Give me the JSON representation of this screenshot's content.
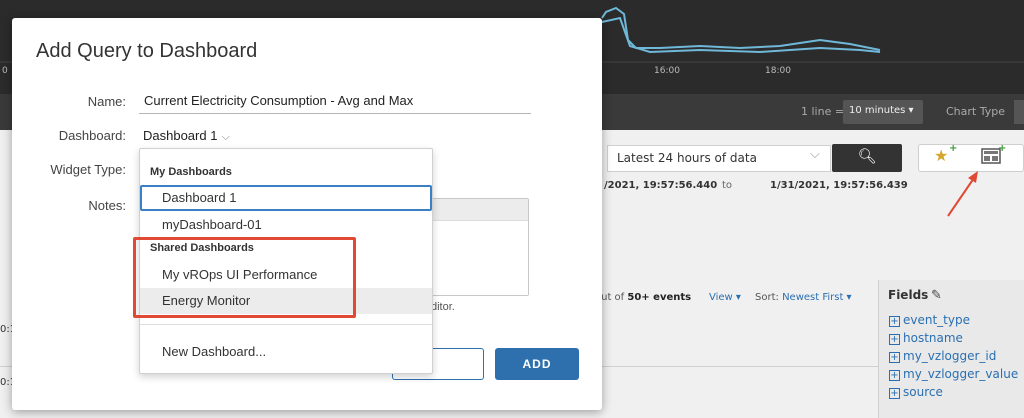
{
  "background": {
    "chart_ticks": [
      "0",
      "16:00",
      "18:00"
    ],
    "toolbar": {
      "one_line_label": "1 line =",
      "interval": "10 minutes ▾",
      "chart_type_label": "Chart Type"
    },
    "time_range_select": "Latest 24 hours of data",
    "range_start": "/2021, 19:57:56.440",
    "range_to": "to",
    "range_end": "1/31/2021, 19:57:56.439",
    "results_prefix": "out of",
    "results_count": "50+ events",
    "view_label": "View ▾",
    "sort_label": "Sort:",
    "sort_value": "Newest First ▾",
    "fields_title": "Fields",
    "fields": [
      "event_type",
      "hostname",
      "my_vzlogger_id",
      "my_vzlogger_value",
      "source"
    ],
    "edge_labels": [
      "0:1",
      "0:1"
    ]
  },
  "modal": {
    "title": "Add Query to Dashboard",
    "name_label": "Name:",
    "name_value": "Current Electricity Consumption - Avg and Max",
    "dashboard_label": "Dashboard:",
    "dashboard_value": "Dashboard 1",
    "widget_type_label": "Widget Type:",
    "notes_label": "Notes:",
    "editor_hint": "ditor.",
    "cancel_label": "NCEL",
    "add_label": "ADD"
  },
  "dropdown": {
    "my_header": "My Dashboards",
    "my_items": [
      "Dashboard 1",
      "myDashboard-01"
    ],
    "shared_header": "Shared Dashboards",
    "shared_items": [
      "My vROps UI Performance",
      "Energy Monitor"
    ],
    "new_item": "New Dashboard..."
  },
  "colors": {
    "accent": "#2e6fad",
    "annotation": "#e04a35",
    "chart_line": "#6fb8d9"
  },
  "icons": [
    "search-icon",
    "star-add-icon",
    "dashboard-add-icon",
    "pencil-icon",
    "chevron-down-icon"
  ]
}
